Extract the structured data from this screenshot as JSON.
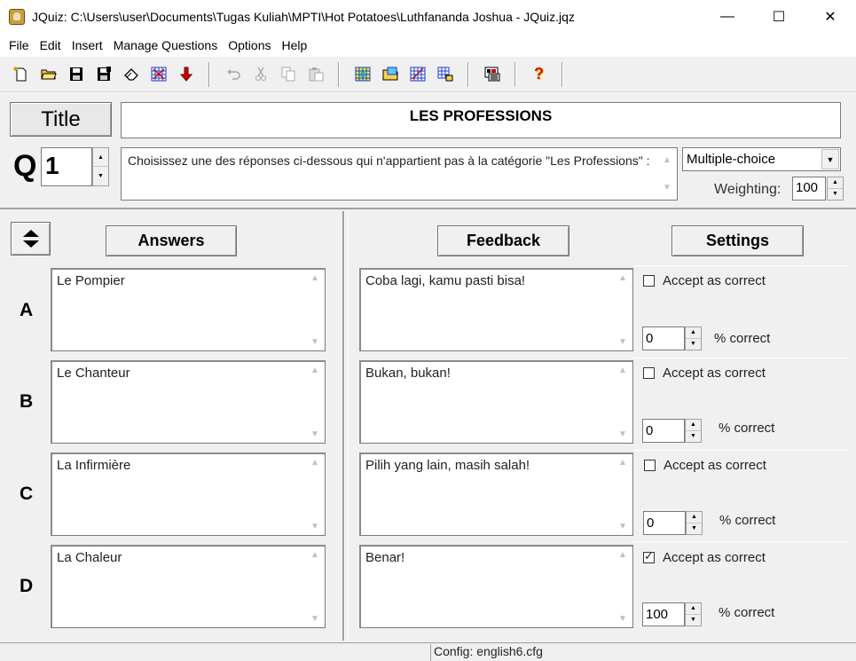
{
  "window": {
    "title": "JQuiz: C:\\Users\\user\\Documents\\Tugas Kuliah\\MPTI\\Hot Potatoes\\Luthfananda Joshua - JQuiz.jqz",
    "minimize": "—",
    "maximize": "☐",
    "close": "✕"
  },
  "menu": [
    "File",
    "Edit",
    "Insert",
    "Manage Questions",
    "Options",
    "Help"
  ],
  "toolbar": {
    "groups": [
      [
        "new-file-icon",
        "open-folder-icon",
        "save-icon",
        "save-as-icon",
        "eraser-icon",
        "web-page-icon",
        "down-arrow-icon"
      ],
      [
        "undo-icon",
        "cut-icon",
        "copy-icon",
        "paste-icon"
      ],
      [
        "web-grid-icon",
        "folder-web-icon",
        "web-grid-alt-icon",
        "web-export-icon"
      ],
      [
        "config-icon"
      ],
      [
        "help-icon"
      ]
    ],
    "help_glyph": "?"
  },
  "header": {
    "title_button": "Title",
    "title_value": "LES PROFESSIONS",
    "q_letter": "Q",
    "question_number": "1",
    "question_text": "Choisissez une des réponses ci-dessous qui n'appartient pas à la catégorie \"Les Professions\" :",
    "question_type": "Multiple-choice",
    "weighting_label": "Weighting:",
    "weighting_value": "100"
  },
  "columns": {
    "answers": "Answers",
    "feedback": "Feedback",
    "settings": "Settings"
  },
  "rows": [
    {
      "letter": "A",
      "answer": "Le Pompier",
      "feedback": "Coba lagi, kamu pasti bisa!",
      "accept_label": "Accept as correct",
      "accepted": false,
      "percent": "0",
      "percent_label": "% correct"
    },
    {
      "letter": "B",
      "answer": "Le Chanteur",
      "feedback": "Bukan, bukan!",
      "accept_label": "Accept as correct",
      "accepted": false,
      "percent": "0",
      "percent_label": "% correct"
    },
    {
      "letter": "C",
      "answer": "La Infirmière",
      "feedback": "Pilih yang lain, masih salah!",
      "accept_label": "Accept as correct",
      "accepted": false,
      "percent": "0",
      "percent_label": "% correct"
    },
    {
      "letter": "D",
      "answer": "La Chaleur",
      "feedback": "Benar!",
      "accept_label": "Accept as correct",
      "accepted": true,
      "percent": "100",
      "percent_label": "% correct"
    }
  ],
  "status": {
    "config": "Config: english6.cfg"
  }
}
